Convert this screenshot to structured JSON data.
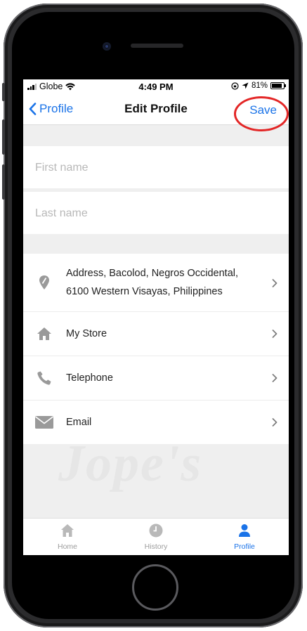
{
  "status_bar": {
    "carrier": "Globe",
    "time": "4:49 PM",
    "battery": "81%"
  },
  "nav": {
    "back_label": "Profile",
    "title": "Edit Profile",
    "save_label": "Save"
  },
  "form": {
    "first_name_placeholder": "First name",
    "last_name_placeholder": "Last name"
  },
  "list": [
    {
      "icon": "location-pin-icon",
      "line1": "Address, Bacolod, Negros Occidental,",
      "line2": "6100 Western Visayas, Philippines"
    },
    {
      "icon": "home-icon",
      "label": "My Store"
    },
    {
      "icon": "phone-icon",
      "label": "Telephone"
    },
    {
      "icon": "mail-icon",
      "label": "Email"
    }
  ],
  "watermark": "Jope's",
  "tabs": [
    {
      "label": "Home",
      "icon": "home-icon",
      "active": false
    },
    {
      "label": "History",
      "icon": "clock-icon",
      "active": false
    },
    {
      "label": "Profile",
      "icon": "person-icon",
      "active": true
    }
  ],
  "colors": {
    "accent": "#1a73e8",
    "annotation": "#e32626",
    "icon_gray": "#9a9a9a"
  }
}
